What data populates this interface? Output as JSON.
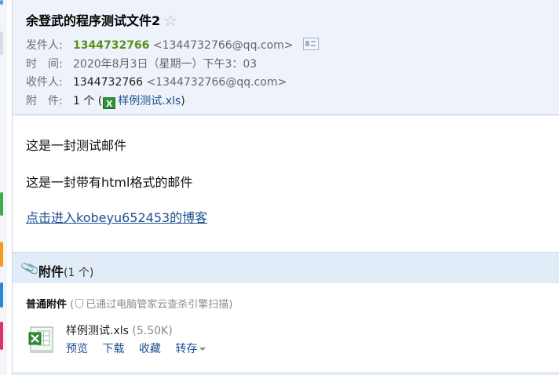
{
  "header": {
    "subject": "余登武的程序测试文件2",
    "star_icon": "☆",
    "from": {
      "label": "发件人:",
      "name": "1344732766",
      "address": "<1344732766@qq.com>"
    },
    "time": {
      "label": "时　间:",
      "value": "2020年8月3日（星期一）下午3：03"
    },
    "to": {
      "label": "收件人:",
      "name": "1344732766",
      "address": "<1344732766@qq.com>"
    },
    "attachment": {
      "label": "附　件:",
      "count_text": "1 个 (",
      "file": "样例测试.xls",
      "close": ")"
    }
  },
  "body": {
    "line1": "这是一封测试邮件",
    "line2": "这是一封带有html格式的邮件",
    "link": "点击进入kobeyu652453的博客"
  },
  "attachments": {
    "title": "附件",
    "count": "(1 个)",
    "section_label": "普通附件",
    "scan_note_open": "(",
    "scan_note": "已通过电脑管家云查杀引擎扫描)",
    "file_name": "样例测试.xls",
    "file_size": "(5.50K)",
    "actions": {
      "preview": "预览",
      "download": "下载",
      "favorite": "收藏",
      "forward": "转存"
    }
  },
  "colors": {
    "sender": "#5a8f1b",
    "link": "#1d4f91",
    "header_bg": "#eef3fb",
    "bar_bg": "#e2ecf8"
  },
  "icons": [
    "star-icon",
    "vcard-icon",
    "excel-icon",
    "paperclip-icon",
    "shield-icon",
    "dropdown-caret-icon"
  ]
}
